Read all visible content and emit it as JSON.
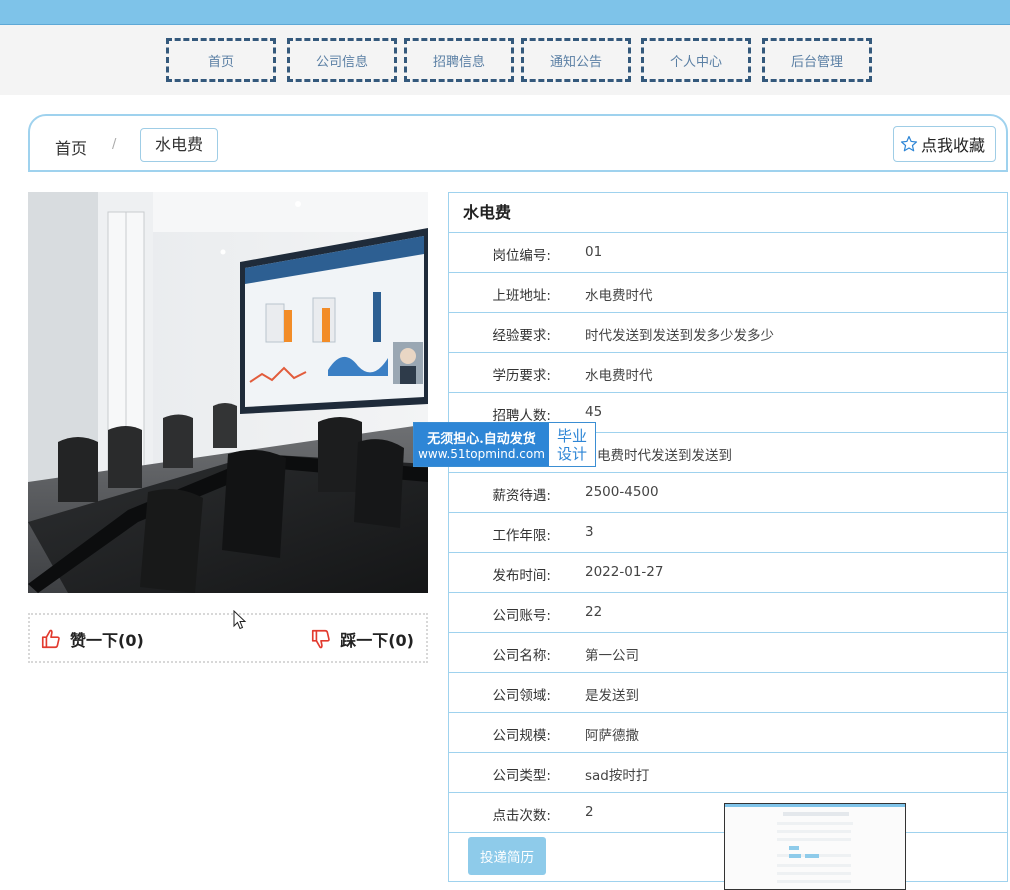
{
  "nav": {
    "items": [
      {
        "label": "首页"
      },
      {
        "label": "公司信息"
      },
      {
        "label": "招聘信息"
      },
      {
        "label": "通知公告"
      },
      {
        "label": "个人中心"
      },
      {
        "label": "后台管理"
      }
    ]
  },
  "breadcrumb": {
    "home": "首页",
    "separator": "/",
    "current": "水电费"
  },
  "favorite": {
    "label": "点我收藏",
    "icon": "star-outline-icon"
  },
  "votes": {
    "like": {
      "label": "赞一下(0)",
      "icon": "thumbs-up-icon"
    },
    "dislike": {
      "label": "踩一下(0)",
      "icon": "thumbs-down-icon"
    }
  },
  "job": {
    "title": "水电费",
    "fields": [
      {
        "label": "岗位编号:",
        "value": "01"
      },
      {
        "label": "上班地址:",
        "value": "水电费时代"
      },
      {
        "label": "经验要求:",
        "value": "时代发送到发送到发多少发多少"
      },
      {
        "label": "学历要求:",
        "value": "水电费时代"
      },
      {
        "label": "招聘人数:",
        "value": "45"
      },
      {
        "label": "",
        "value": "电费时代发送到发送到"
      },
      {
        "label": "薪资待遇:",
        "value": "2500-4500"
      },
      {
        "label": "工作年限:",
        "value": "3"
      },
      {
        "label": "发布时间:",
        "value": "2022-01-27"
      },
      {
        "label": "公司账号:",
        "value": "22"
      },
      {
        "label": "公司名称:",
        "value": "第一公司"
      },
      {
        "label": "公司领域:",
        "value": "是发送到"
      },
      {
        "label": "公司规模:",
        "value": "阿萨德撒"
      },
      {
        "label": "公司类型:",
        "value": "sad按时打"
      },
      {
        "label": "点击次数:",
        "value": "2"
      }
    ],
    "apply_label": "投递简历"
  },
  "watermark": {
    "line1": "无须担心.自动发货",
    "line2": "www.51topmind.com",
    "badge1": "毕业",
    "badge2": "设计"
  },
  "colors": {
    "accent": "#7ec3e9",
    "nav_border": "#34597c",
    "border": "#9fd2ee",
    "button": "#8ecbea",
    "like_icon": "#e23a2e"
  }
}
